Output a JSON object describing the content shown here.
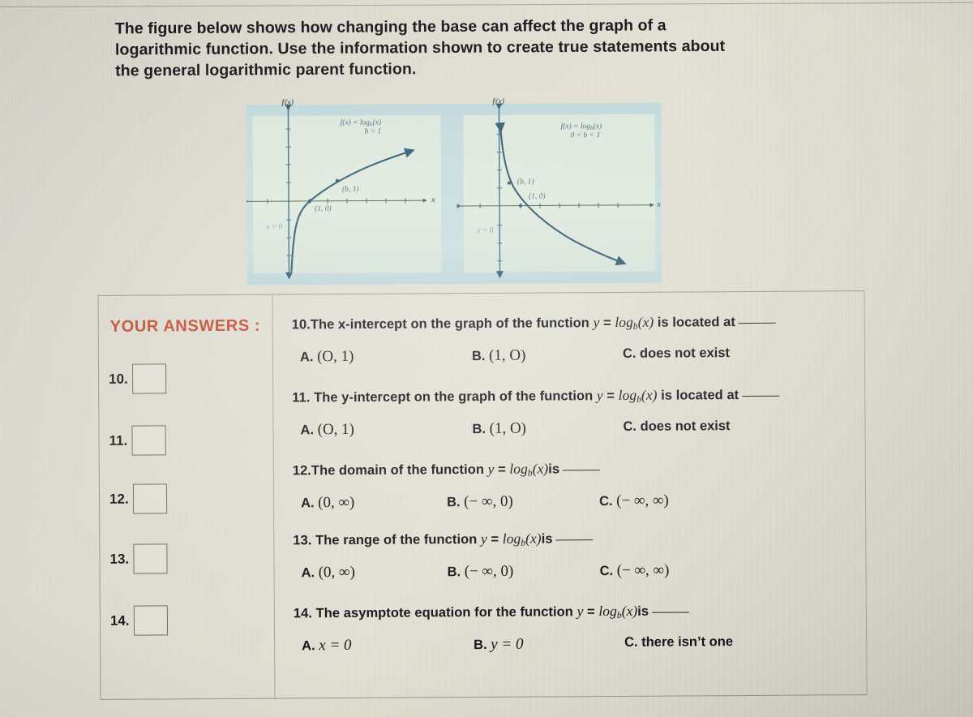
{
  "prompt": {
    "line1": "The figure below shows how changing the base can affect the graph of a",
    "line2": "logarithmic function. Use the information shown to create true statements about",
    "line3": "the general logarithmic parent function."
  },
  "figure": {
    "left_graph": {
      "y_axis_label": "f(x)",
      "x_axis_label": "x",
      "function_label": "f(x) = log",
      "function_label_sub": "b",
      "function_label_tail": "(x)",
      "condition": "b > 1",
      "point_b1": "(b, 1)",
      "point_10": "(1, 0)",
      "asymptote": "x = 0"
    },
    "right_graph": {
      "y_axis_label": "f(x)",
      "x_axis_label": "x",
      "function_label": "f(x) = log",
      "function_label_sub": "b",
      "function_label_tail": "(x)",
      "condition": "0 < b < 1",
      "point_b1": "(b, 1)",
      "point_10": "(1, 0)",
      "asymptote": "x = 0"
    }
  },
  "answers_panel": {
    "title": "YOUR ANSWERS :",
    "rows": [
      {
        "number": "10."
      },
      {
        "number": "11."
      },
      {
        "number": "12."
      },
      {
        "number": "13."
      },
      {
        "number": "14."
      }
    ]
  },
  "questions": [
    {
      "number": "10.",
      "text_before": "The x-intercept on the graph of the function ",
      "eq_y": "y",
      "eq_eq": " = ",
      "eq_log": "log",
      "eq_sub": "b",
      "eq_arg": "(x)",
      "text_after": " is located at",
      "options": [
        {
          "lead": "A.",
          "value": "(O, 1)"
        },
        {
          "lead": "B.",
          "value": "(1, O)"
        },
        {
          "lead": "C.",
          "value": "does not exist"
        }
      ]
    },
    {
      "number": "11.",
      "text_before": "The y-intercept on the graph of the function ",
      "eq_y": "y",
      "eq_eq": " = ",
      "eq_log": "log",
      "eq_sub": "b",
      "eq_arg": "(x)",
      "text_after": " is located at",
      "options": [
        {
          "lead": "A.",
          "value": "(O, 1)"
        },
        {
          "lead": "B.",
          "value": "(1, O)"
        },
        {
          "lead": "C.",
          "value": "does not exist"
        }
      ]
    },
    {
      "number": "12.",
      "text_before": "The domain of the function ",
      "eq_y": "y",
      "eq_eq": " = ",
      "eq_log": "log",
      "eq_sub": "b",
      "eq_arg": "(x)",
      "text_after": "is",
      "options": [
        {
          "lead": "A.",
          "value": "(0, ∞)"
        },
        {
          "lead": "B.",
          "value": "(− ∞, 0)"
        },
        {
          "lead": "C.",
          "value": "(− ∞, ∞)"
        }
      ]
    },
    {
      "number": "13.",
      "text_before": "The range of the function ",
      "eq_y": "y",
      "eq_eq": " = ",
      "eq_log": "log",
      "eq_sub": "b",
      "eq_arg": "(x)",
      "text_after": "is",
      "options": [
        {
          "lead": "A.",
          "value": "(0, ∞)"
        },
        {
          "lead": "B.",
          "value": "(− ∞, 0)"
        },
        {
          "lead": "C.",
          "value": "(− ∞, ∞)"
        }
      ]
    },
    {
      "number": "14.",
      "text_before": "The asymptote equation for the function ",
      "eq_y": "y",
      "eq_eq": " = ",
      "eq_log": "log",
      "eq_sub": "b",
      "eq_arg": "(x)",
      "text_after": "is",
      "options": [
        {
          "lead": "A.",
          "value": "x = 0",
          "italic_first": true
        },
        {
          "lead": "B.",
          "value": "y = 0",
          "italic_first": true
        },
        {
          "lead": "C.",
          "value": "there isn’t one"
        }
      ]
    }
  ],
  "colors": {
    "accent_orange": "#c2492d",
    "text": "#14131a",
    "figure_band": "#c2dade",
    "figure_panel": "#e0e9dc",
    "curve": "#2e5a74",
    "paper": "#ddd9cd"
  }
}
